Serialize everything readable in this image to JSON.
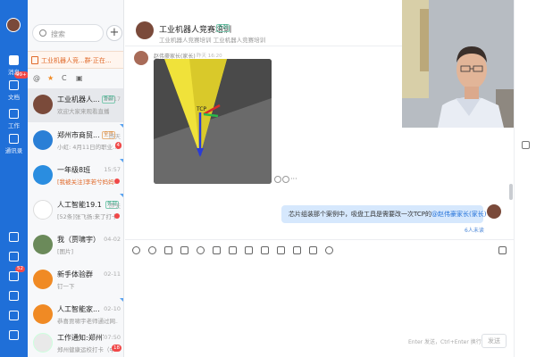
{
  "nav": {
    "badge": "99+",
    "badge2": "52",
    "items": [
      {
        "label": "消息",
        "icon": "chat-bubble-icon"
      },
      {
        "label": "文档",
        "icon": "document-icon"
      },
      {
        "label": "工作",
        "icon": "grid-icon"
      },
      {
        "label": "通讯录",
        "icon": "contacts-icon"
      }
    ]
  },
  "search": {
    "placeholder": "搜索"
  },
  "pinned": {
    "text": "工业机器人竞...群·正在..."
  },
  "conversations": [
    {
      "name": "工业机器人...",
      "tag": "外部",
      "time": "16:17",
      "preview": "欢迎大家来观看直播",
      "selected": true
    },
    {
      "name": "郑州市商贸...",
      "tag": "全员",
      "time": "昨天",
      "preview": "小虹: 4月11日的职业...",
      "count": "4"
    },
    {
      "name": "一年级8班",
      "tag": "",
      "time": "15:57",
      "preview": "[我被关注]李若兮妈妈...",
      "dot": true
    },
    {
      "name": "人工智能19.1",
      "tag": "外部",
      "time": "昨天",
      "preview": "[52条]张飞扬:来了打卡",
      "dot": true
    },
    {
      "name": "我（贾啸宇）",
      "tag": "",
      "time": "04-02",
      "preview": "[图片]"
    },
    {
      "name": "新手体验群",
      "tag": "",
      "time": "02-11",
      "preview": "钉一下"
    },
    {
      "name": "人工智能家...",
      "tag": "",
      "time": "02-10",
      "preview": "恭喜贾啸宇老师通过网..."
    },
    {
      "name": "工作通知:郑州市...",
      "tag": "",
      "time": "07:50",
      "preview": "郑州健康运校打卡（中...",
      "count": "18"
    }
  ],
  "chat": {
    "title": "工业机器人竞赛培训",
    "title_tag": "外部",
    "subtitle": "工业机器人竞赛培训 工业机器人竞赛培训",
    "incoming": {
      "sender": "赵伟豪家长(家长)",
      "time": "昨天 16:20"
    },
    "image_labels": {
      "tcp": "TCP"
    },
    "outgoing": {
      "text": "芯片组装那个案例中，吸盘工具是需要改一次TCP的",
      "mention": "@赵伟豪家长(家长)"
    },
    "read_status": "6人未读",
    "input_hint": "Enter 发送，Ctrl+Enter 换行",
    "send_label": "发送"
  }
}
